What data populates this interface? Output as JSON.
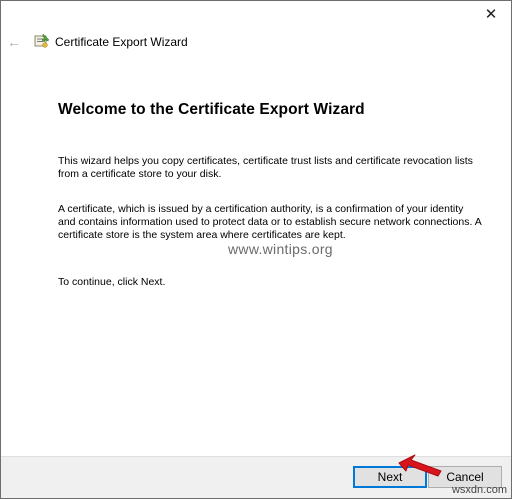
{
  "window": {
    "close_glyph": "✕",
    "title": "Certificate Export Wizard",
    "back_glyph": "←"
  },
  "main": {
    "heading": "Welcome to the Certificate Export Wizard",
    "para1": "This wizard helps you copy certificates, certificate trust lists and certificate revocation lists from a certificate store to your disk.",
    "para2": "A certificate, which is issued by a certification authority, is a confirmation of your identity and contains information used to protect data or to establish secure network connections. A certificate store is the system area where certificates are kept.",
    "para3": "To continue, click Next.",
    "watermark": "www.wintips.org"
  },
  "footer": {
    "next_label": "Next",
    "cancel_label": "Cancel",
    "site_mark": "wsxdn.com"
  },
  "colors": {
    "accent_border": "#0078d7",
    "arrow_red": "#d8141c"
  },
  "icons": {
    "back": "back-arrow-icon",
    "wizard": "certificate-wizard-icon",
    "close": "close-icon"
  }
}
